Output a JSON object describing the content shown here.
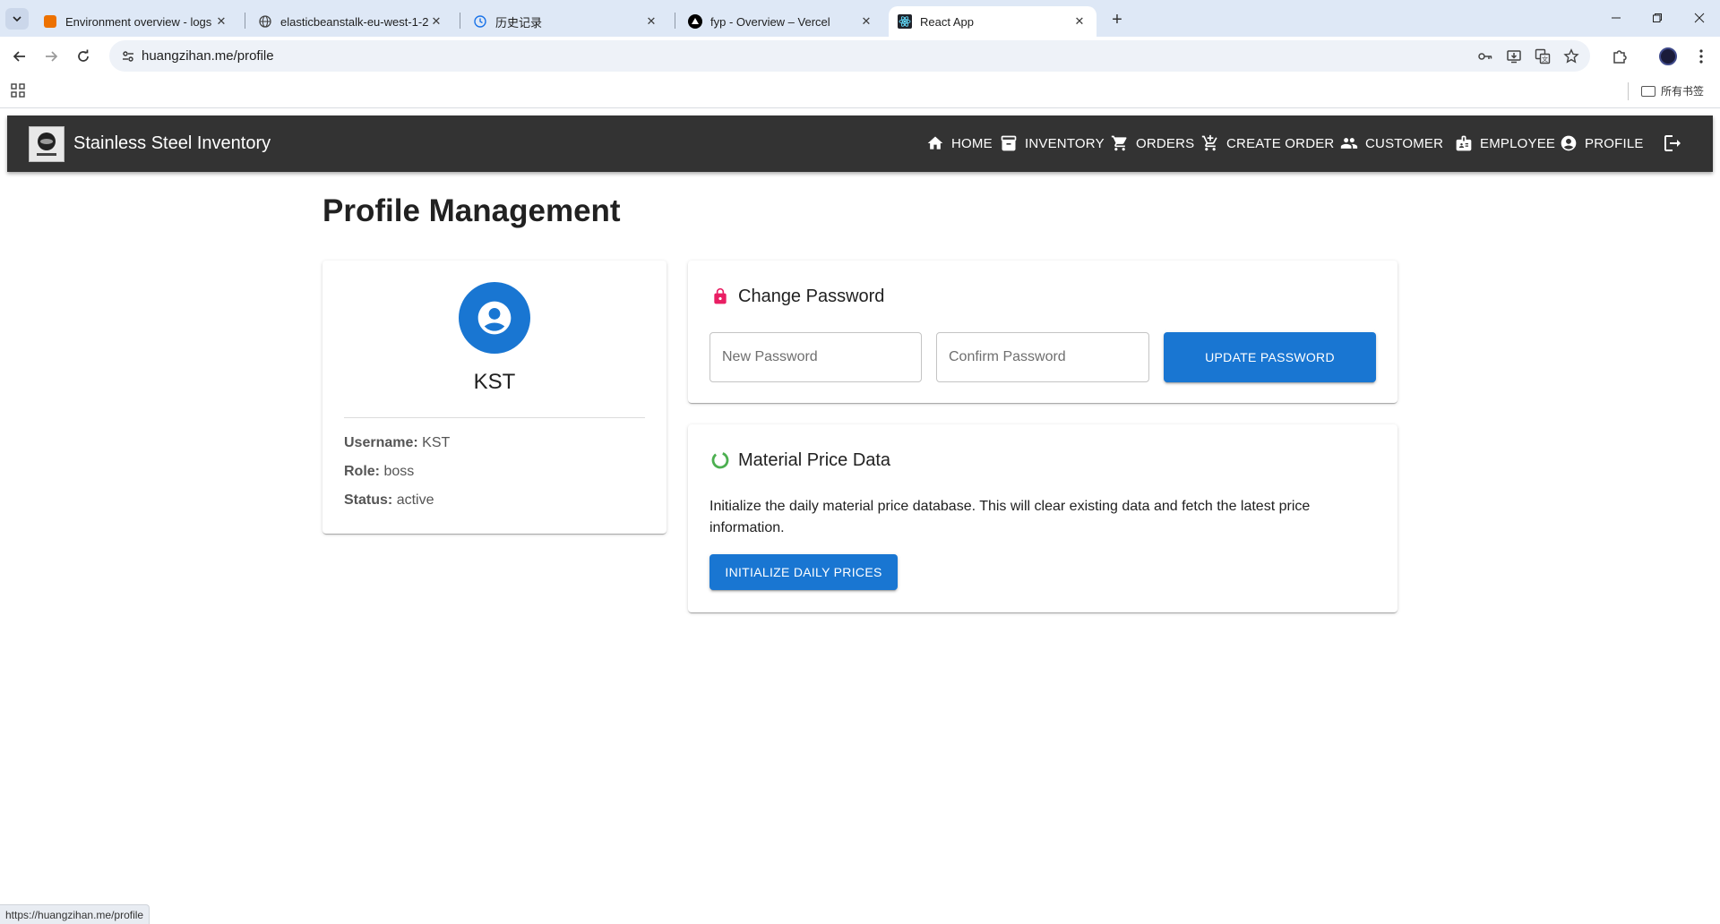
{
  "browser": {
    "tabs": [
      {
        "title": "Environment overview - logs",
        "favicon": "aws-elasticbeanstalk-icon",
        "active": false
      },
      {
        "title": "elasticbeanstalk-eu-west-1-2",
        "favicon": "globe-icon",
        "active": false
      },
      {
        "title": "历史记录",
        "favicon": "history-icon",
        "active": false
      },
      {
        "title": "fyp - Overview – Vercel",
        "favicon": "vercel-icon",
        "active": false
      },
      {
        "title": "React App",
        "favicon": "react-icon",
        "active": true
      }
    ],
    "url": "huangzihan.me/profile",
    "bookmarks_all_label": "所有书签",
    "status_url": "https://huangzihan.me/profile"
  },
  "app": {
    "brand": "Stainless Steel Inventory",
    "nav": [
      {
        "label": "HOME",
        "icon": "home-icon"
      },
      {
        "label": "INVENTORY",
        "icon": "inventory-icon"
      },
      {
        "label": "ORDERS",
        "icon": "cart-icon"
      },
      {
        "label": "CREATE ORDER",
        "icon": "add-cart-icon"
      },
      {
        "label": "CUSTOMER",
        "icon": "people-icon"
      },
      {
        "label": "EMPLOYEE",
        "icon": "badge-icon"
      },
      {
        "label": "PROFILE",
        "icon": "account-circle-icon"
      }
    ],
    "logout_icon": "logout-icon"
  },
  "page": {
    "title": "Profile Management",
    "profile": {
      "name": "KST",
      "username_label": "Username:",
      "username": "KST",
      "role_label": "Role:",
      "role": "boss",
      "status_label": "Status:",
      "status": "active"
    },
    "change_password": {
      "heading": "Change Password",
      "new_placeholder": "New Password",
      "confirm_placeholder": "Confirm Password",
      "button": "UPDATE PASSWORD",
      "icon_color": "#e91e63"
    },
    "material_price": {
      "heading": "Material Price Data",
      "description": "Initialize the daily material price database. This will clear existing data and fetch the latest price information.",
      "button": "INITIALIZE DAILY PRICES",
      "icon_color": "#4caf50"
    }
  },
  "colors": {
    "primary": "#1976d2",
    "appbar": "#333333"
  }
}
